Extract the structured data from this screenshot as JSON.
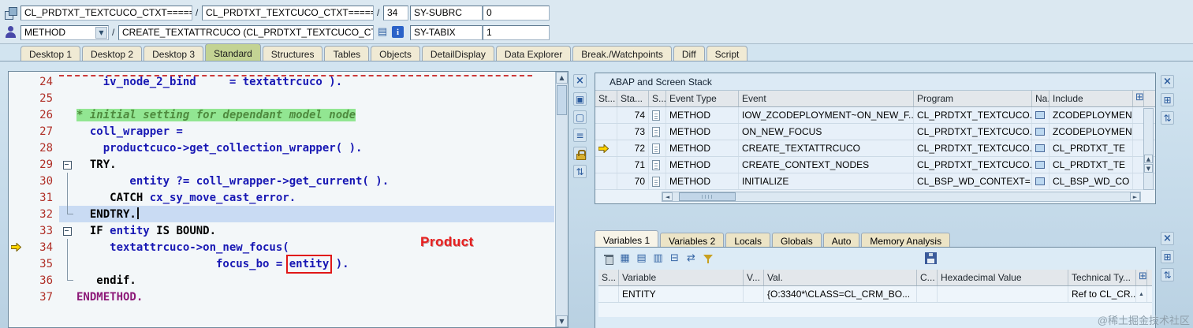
{
  "topbar": {
    "separator": "/",
    "row1": {
      "main_program": "CL_PRDTXT_TEXTCUCO_CTXT======..",
      "source_name": "CL_PRDTXT_TEXTCUCO_CTXT======..",
      "line_number": "34",
      "sy_subrc_label": "SY-SUBRC",
      "sy_subrc_value": "0"
    },
    "row2": {
      "event_type": "METHOD",
      "event_name": "CREATE_TEXTATTRCUCO (CL_PRDTXT_TEXTCUCO_CT..",
      "sy_tabix_label": "SY-TABIX",
      "sy_tabix_value": "1"
    }
  },
  "desktop_tabs": [
    {
      "label": "Desktop 1",
      "active": false
    },
    {
      "label": "Desktop 2",
      "active": false
    },
    {
      "label": "Desktop 3",
      "active": false
    },
    {
      "label": "Standard",
      "active": true
    },
    {
      "label": "Structures",
      "active": false
    },
    {
      "label": "Tables",
      "active": false
    },
    {
      "label": "Objects",
      "active": false
    },
    {
      "label": "DetailDisplay",
      "active": false
    },
    {
      "label": "Data Explorer",
      "active": false
    },
    {
      "label": "Break./Watchpoints",
      "active": false
    },
    {
      "label": "Diff",
      "active": false
    },
    {
      "label": "Script",
      "active": false
    }
  ],
  "editor": {
    "annotation": "Product",
    "lines": [
      {
        "num": "24",
        "fold": "",
        "segments": [
          {
            "t": "    iv_node_2_bind     = textattrcuco ).",
            "c": "b"
          }
        ]
      },
      {
        "num": "25",
        "fold": "",
        "segments": []
      },
      {
        "num": "26",
        "fold": "",
        "segments": [
          {
            "t": "* initial setting for dependant model node",
            "c": "c"
          }
        ]
      },
      {
        "num": "27",
        "fold": "",
        "segments": [
          {
            "t": "  coll_wrapper =",
            "c": "b"
          }
        ]
      },
      {
        "num": "28",
        "fold": "",
        "segments": [
          {
            "t": "    productcuco->get_collection_wrapper( ).",
            "c": "b"
          }
        ]
      },
      {
        "num": "29",
        "fold": "box",
        "segments": [
          {
            "t": "  TRY.",
            "c": "k"
          }
        ]
      },
      {
        "num": "30",
        "fold": "line",
        "segments": [
          {
            "t": "        entity ?= coll_wrapper->get_current( ).",
            "c": "b"
          }
        ]
      },
      {
        "num": "31",
        "fold": "line",
        "segments": [
          {
            "t": "     CATCH ",
            "c": "k"
          },
          {
            "t": "cx_sy_move_cast_error.",
            "c": "b"
          }
        ]
      },
      {
        "num": "32",
        "fold": "corner",
        "current": true,
        "caret": true,
        "segments": [
          {
            "t": "  ENDTRY.",
            "c": "k"
          }
        ]
      },
      {
        "num": "33",
        "fold": "box",
        "segments": [
          {
            "t": "  IF ",
            "c": "k"
          },
          {
            "t": "entity ",
            "c": "b"
          },
          {
            "t": "IS BOUND.",
            "c": "k"
          }
        ]
      },
      {
        "num": "34",
        "fold": "line",
        "arrow": true,
        "segments": [
          {
            "t": "     textattrcuco->on_new_focus(",
            "c": "b"
          }
        ]
      },
      {
        "num": "35",
        "fold": "line",
        "segments": [
          {
            "t": "                     focus_bo = ",
            "c": "b"
          },
          {
            "t": "entity",
            "c": "b",
            "box": true
          },
          {
            "t": " ).",
            "c": "b"
          }
        ]
      },
      {
        "num": "36",
        "fold": "corner",
        "segments": [
          {
            "t": "   endif.",
            "c": "k"
          }
        ]
      },
      {
        "num": "37",
        "fold": "",
        "segments": [
          {
            "t": "ENDMETHOD.",
            "c": "e"
          }
        ]
      }
    ]
  },
  "tool_strips": {
    "editor": [
      "close-icon",
      "services-icon",
      "display-icon",
      "list-icon",
      "lock-icon",
      "swap-icon"
    ],
    "stack": [
      "close-icon",
      "table-settings-icon",
      "swap-icon"
    ],
    "variables": [
      "close-icon",
      "table-settings-icon",
      "swap-icon"
    ]
  },
  "stack": {
    "title": "ABAP and Screen Stack",
    "columns": [
      "St...",
      "Sta...",
      "S...",
      "Event Type",
      "Event",
      "Program",
      "Na...",
      "Include"
    ],
    "rows": [
      {
        "step": "74",
        "event_type": "METHOD",
        "event": "IOW_ZCODEPLOYMENT~ON_NEW_F...",
        "program": "CL_PRDTXT_TEXTCUCO...",
        "include": "ZCODEPLOYMEN",
        "current": false
      },
      {
        "step": "73",
        "event_type": "METHOD",
        "event": "ON_NEW_FOCUS",
        "program": "CL_PRDTXT_TEXTCUCO...",
        "include": "ZCODEPLOYMEN",
        "current": false
      },
      {
        "step": "72",
        "event_type": "METHOD",
        "event": "CREATE_TEXTATTRCUCO",
        "program": "CL_PRDTXT_TEXTCUCO...",
        "include": "CL_PRDTXT_TE",
        "current": true
      },
      {
        "step": "71",
        "event_type": "METHOD",
        "event": "CREATE_CONTEXT_NODES",
        "program": "CL_PRDTXT_TEXTCUCO...",
        "include": "CL_PRDTXT_TE",
        "current": false
      },
      {
        "step": "70",
        "event_type": "METHOD",
        "event": "INITIALIZE",
        "program": "CL_BSP_WD_CONTEXT=...",
        "include": "CL_BSP_WD_CO",
        "current": false
      }
    ]
  },
  "variables": {
    "tabs": [
      {
        "label": "Variables 1",
        "active": true
      },
      {
        "label": "Variables 2",
        "active": false
      },
      {
        "label": "Locals",
        "active": false
      },
      {
        "label": "Globals",
        "active": false
      },
      {
        "label": "Auto",
        "active": false
      },
      {
        "label": "Memory Analysis",
        "active": false
      }
    ],
    "toolbar_icons": [
      "delete-icon",
      "table-create-icon",
      "table-display-icon",
      "table-append-icon",
      "table-columns-icon",
      "swap-rows-icon",
      "filter-icon"
    ],
    "columns": [
      "S...",
      "Variable",
      "V...",
      "Val.",
      "C...",
      "Hexadecimal Value",
      "Technical Ty..."
    ],
    "rows": [
      {
        "variable": "ENTITY",
        "val": "{O:3340*\\CLASS=CL_CRM_BO...",
        "hex": "",
        "technical": "Ref to CL_CR..."
      }
    ]
  },
  "watermark": "@稀土掘金技术社区"
}
